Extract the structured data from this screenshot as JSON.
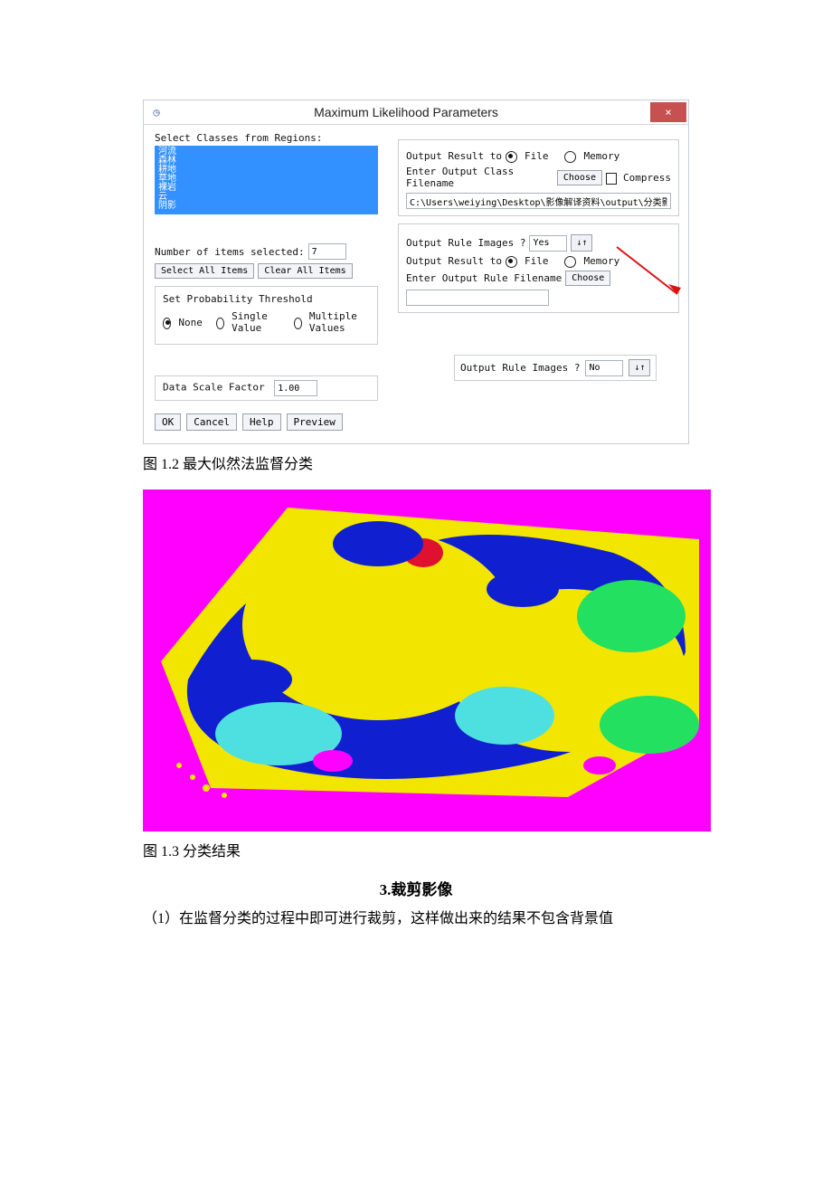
{
  "dialog": {
    "title": "Maximum Likelihood Parameters",
    "close": "×",
    "left": {
      "select_classes_label": "Select Classes from Regions:",
      "classes_text": "河流\n森林\n耕地\n草地\n裸岩\n云\n阴影",
      "num_items_label": "Number of items selected:",
      "num_items_value": "7",
      "select_all": "Select All Items",
      "clear_all": "Clear All Items",
      "threshold_label": "Set Probability Threshold",
      "radio_none": "None",
      "radio_single": "Single Value",
      "radio_multi": "Multiple Values",
      "scale_label": "Data Scale Factor",
      "scale_value": "1.00",
      "ok": "OK",
      "cancel": "Cancel",
      "help": "Help",
      "preview": "Preview"
    },
    "right": {
      "output_result_to": "Output Result to",
      "file": "File",
      "memory": "Memory",
      "class_filename_label": "Enter Output Class Filename",
      "choose": "Choose",
      "compress": "Compress",
      "class_filename_value": "C:\\Users\\weiying\\Desktop\\影像解译资料\\output\\分类影",
      "rule_yes_label": "Output Rule Images ?",
      "rule_yes_value": "Yes",
      "rule_filename_label": "Enter Output Rule Filename",
      "toggle": "↓↑",
      "rule_no_label": "Output Rule Images ?",
      "rule_no_value": "No"
    }
  },
  "caption1": "图 1.2 最大似然法监督分类",
  "caption2": "图 1.3 分类结果",
  "section3_title": "3.裁剪影像",
  "body1": "（1）在监督分类的过程中即可进行裁剪，这样做出来的结果不包含背景值"
}
